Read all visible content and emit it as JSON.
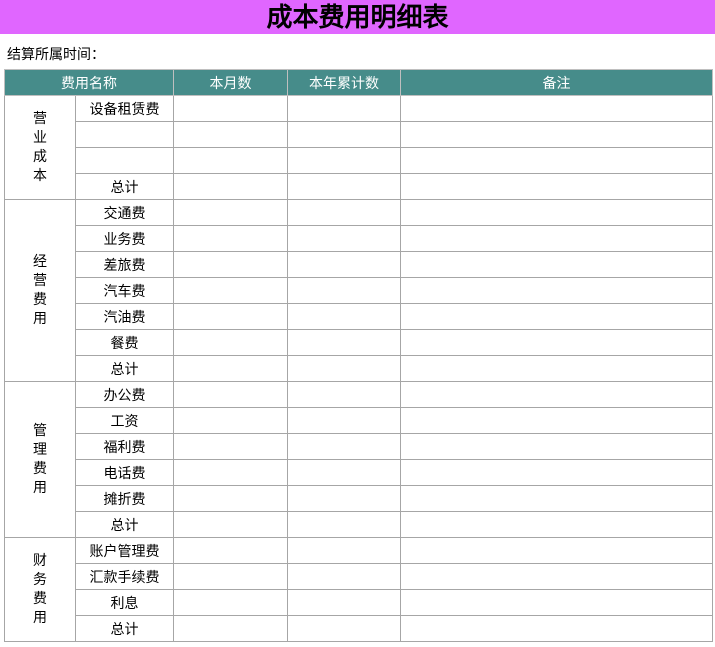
{
  "title": "成本费用明细表",
  "settlement_label": "结算所属时间：",
  "headers": [
    "费用名称",
    "本月数",
    "本年累计数",
    "备注"
  ],
  "groups": [
    {
      "name": "营\n业\n成\n本",
      "items": [
        "设备租赁费",
        "",
        "",
        "总计"
      ]
    },
    {
      "name": "经\n营\n费\n用",
      "items": [
        "交通费",
        "业务费",
        "差旅费",
        "汽车费",
        "汽油费",
        "餐费",
        "总计"
      ]
    },
    {
      "name": "管\n理\n费\n用",
      "items": [
        "办公费",
        "工资",
        "福利费",
        "电话费",
        "摊折费",
        "总计"
      ]
    },
    {
      "name": "财\n务\n费\n用",
      "items": [
        "账户管理费",
        "汇款手续费",
        "利息",
        "总计"
      ]
    }
  ],
  "colors": {
    "title_bg": "#e066ff",
    "header_bg": "#468c8a"
  }
}
